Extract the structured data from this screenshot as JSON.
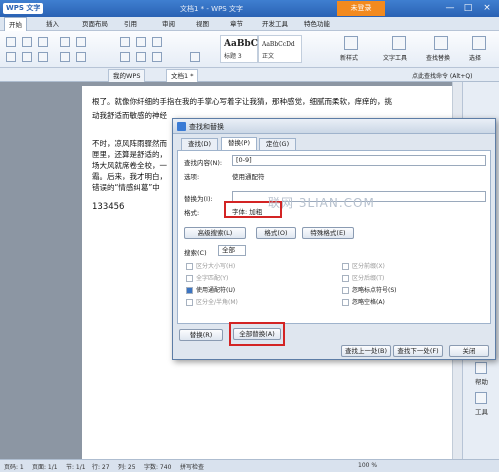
{
  "window": {
    "app_name": "WPS 文字",
    "title": "文档1 * - WPS 文字",
    "login": "未登录",
    "controls": [
      "—",
      "□",
      "×"
    ]
  },
  "menu": [
    "开始",
    "插入",
    "页面布局",
    "引用",
    "审阅",
    "视图",
    "章节",
    "开发工具",
    "特色功能"
  ],
  "ribbon": {
    "styles": [
      {
        "sample": "AaBbC",
        "label": "标题 3"
      },
      {
        "sample": "AaBbCcDd",
        "label": "正文"
      }
    ],
    "new_style": "新样式",
    "text_tools": "文字工具",
    "find_replace": "查找替换",
    "select": "选择"
  },
  "tabs": {
    "home": "我的WPS",
    "doc": "文档1 *",
    "hint": "点此查找命令 (Alt+Q)"
  },
  "document": {
    "lines": [
      "根了。就像你纤细的手指在我的手掌心写着字让我猜，那种感觉，细腻而柔软，痒痒的，挑",
      "动我舒适而敏感的神经",
      "不时，凉风阵雨骤然而",
      "匣里，还算是舒适的，",
      "场大风就席卷全校，一",
      "霜。后来，我才明白，",
      "错误的“情感纠葛”中",
      "133456"
    ]
  },
  "right_panel": {
    "help": "帮助",
    "tools": "工具"
  },
  "dialog": {
    "title": "查找和替换",
    "tabs": [
      "查找(D)",
      "替换(P)",
      "定位(G)"
    ],
    "find_label": "查找内容(N):",
    "find_value": "[0-9]",
    "options_label": "选项:",
    "options_value": "使用通配符",
    "replace_label": "替换为(I):",
    "replace_value": "",
    "format_label": "格式:",
    "format_value": "字体: 加粗",
    "btn_advanced": "高级搜索(L)",
    "btn_format": "格式(O)",
    "btn_special": "特殊格式(E)",
    "search_label": "搜索(C)",
    "search_scope": "全部",
    "options_left": [
      {
        "label": "区分大小写(H)",
        "checked": false,
        "enabled": false
      },
      {
        "label": "全字匹配(Y)",
        "checked": false,
        "enabled": false
      },
      {
        "label": "使用通配符(U)",
        "checked": true,
        "enabled": true
      },
      {
        "label": "区分全/半角(M)",
        "checked": false,
        "enabled": false
      }
    ],
    "options_right": [
      {
        "label": "区分前缀(X)",
        "checked": false,
        "enabled": false
      },
      {
        "label": "区分后缀(T)",
        "checked": false,
        "enabled": false
      },
      {
        "label": "忽略标点符号(S)",
        "checked": false,
        "enabled": true
      },
      {
        "label": "忽略空格(A)",
        "checked": false,
        "enabled": true
      }
    ],
    "btn_replace": "替换(R)",
    "btn_replace_all": "全部替换(A)",
    "btn_find_prev": "查找上一处(B)",
    "btn_find_next": "查找下一处(F)",
    "btn_close": "关闭"
  },
  "watermark": "联网 3LIAN.COM",
  "status": {
    "page": "页码: 1",
    "pages": "页面: 1/1",
    "section": "节: 1/1",
    "line": "行: 27",
    "col": "列: 25",
    "words": "字数: 740",
    "spell": "拼写检查",
    "zoom": "100 %"
  }
}
